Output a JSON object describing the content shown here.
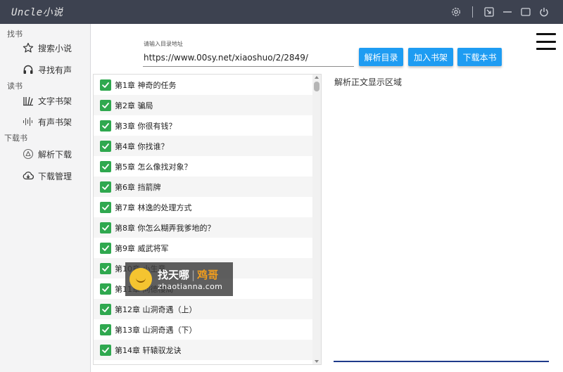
{
  "window": {
    "title": "Uncle小说"
  },
  "sidebar": {
    "sections": [
      {
        "title": "找书",
        "items": [
          {
            "label": "搜索小说",
            "icon": "star-icon"
          },
          {
            "label": "寻找有声",
            "icon": "headphones-icon"
          }
        ]
      },
      {
        "title": "读书",
        "items": [
          {
            "label": "文字书架",
            "icon": "books-icon"
          },
          {
            "label": "有声书架",
            "icon": "audio-wave-icon"
          }
        ]
      },
      {
        "title": "下载书",
        "items": [
          {
            "label": "解析下载",
            "icon": "triangle-circle-icon"
          },
          {
            "label": "下载管理",
            "icon": "cloud-download-icon"
          }
        ]
      }
    ]
  },
  "url_bar": {
    "label": "请输入目录地址",
    "value": "https://www.00sy.net/xiaoshuo/2/2849/"
  },
  "buttons": {
    "parse_catalog": "解析目录",
    "add_shelf": "加入书架",
    "download_book": "下载本书"
  },
  "chapters": [
    "第1章 神奇的任务",
    "第2章 骗局",
    "第3章 你很有钱？",
    "第4章 你找谁？",
    "第5章 怎么像找对象？",
    "第6章 挡箭牌",
    "第7章 林逸的处理方式",
    "第8章 你怎么糊弄我爹地的？",
    "第9章 威武将军",
    "第10章 小生意",
    "第11章 同德楼局",
    "第12章 山洞奇遇（上）",
    "第13章 山洞奇遇（下）",
    "第14章 轩辕驭龙诀"
  ],
  "content_area": {
    "placeholder": "解析正文显示区域"
  },
  "watermark": {
    "brand": "找天哪",
    "sub": "鸡哥",
    "url": "zhaotianna.com"
  },
  "colors": {
    "titlebar": "#3d4250",
    "accent": "#1e9cf2",
    "checkbox": "#2fa84f",
    "sidebar_bg": "#f4f4f5"
  }
}
